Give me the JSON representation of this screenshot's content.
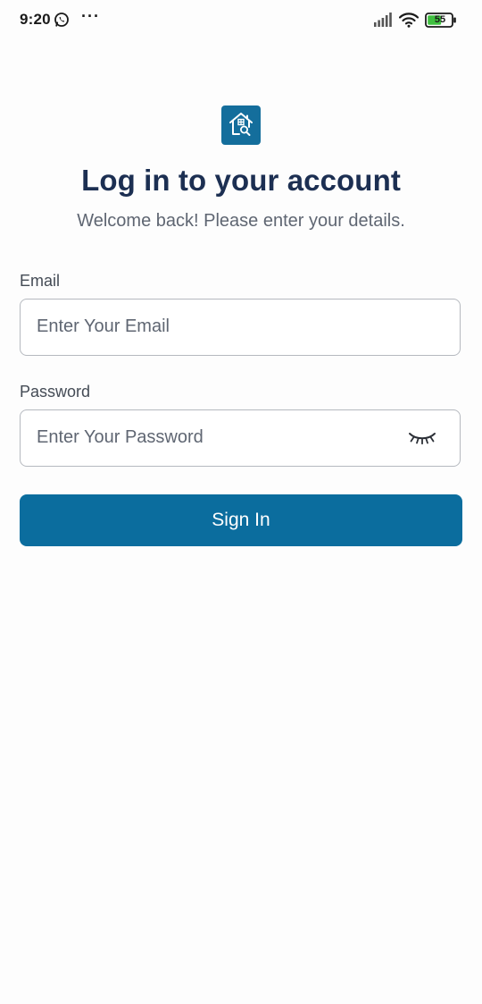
{
  "status_bar": {
    "time": "9:20",
    "dots": "···",
    "battery_level": "55",
    "icons": [
      "whatsapp-icon",
      "signal-icon",
      "wifi-icon",
      "battery-icon"
    ]
  },
  "logo": {
    "icon": "house-search-icon",
    "color": "#146e9c"
  },
  "header": {
    "title": "Log in to your account",
    "subtitle": "Welcome back! Please enter your details."
  },
  "form": {
    "email": {
      "label": "Email",
      "placeholder": "Enter Your Email",
      "value": ""
    },
    "password": {
      "label": "Password",
      "placeholder": "Enter Your Password",
      "value": "",
      "toggle_icon": "eye-closed-icon"
    },
    "submit_label": "Sign In"
  },
  "colors": {
    "primary": "#0b6d9e",
    "title": "#1c2f52",
    "muted_text": "#5f6672",
    "border": "#b5b9bf"
  }
}
